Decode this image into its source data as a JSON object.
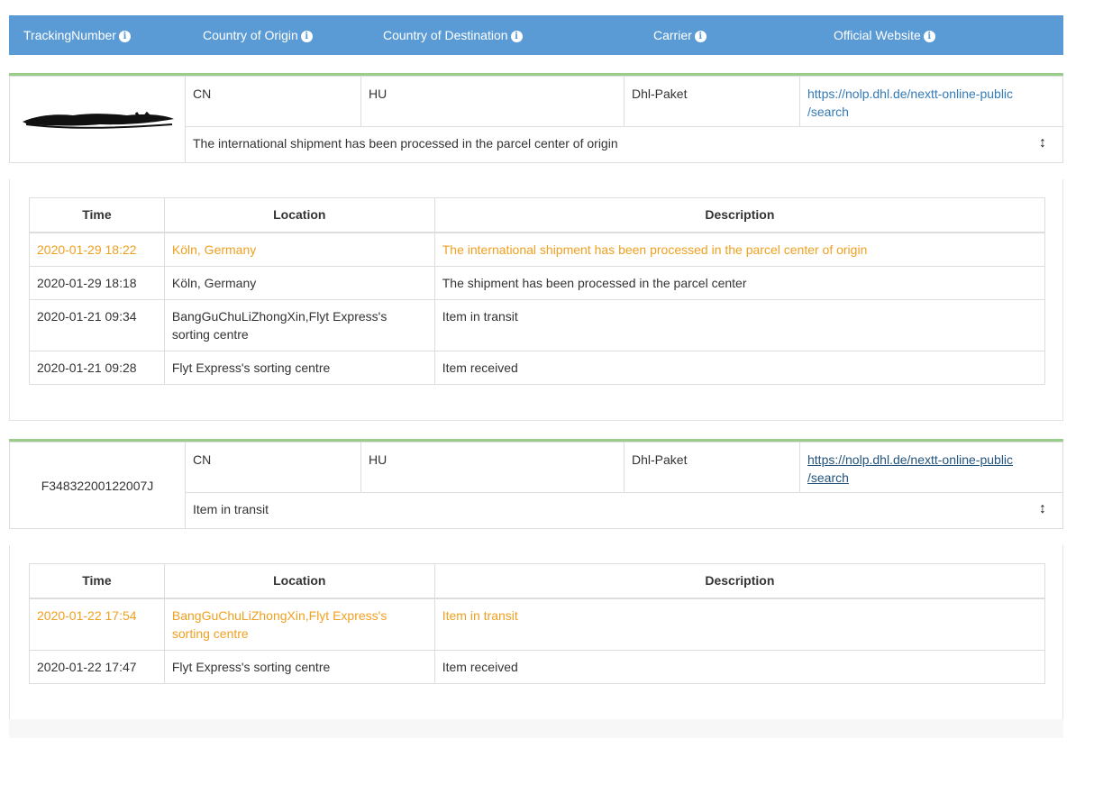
{
  "header": {
    "tracking_number": "TrackingNumber",
    "origin": "Country of Origin",
    "destination": "Country of Destination",
    "carrier": "Carrier",
    "website": "Official Website",
    "info_glyph": "i"
  },
  "table_headers": {
    "time": "Time",
    "location": "Location",
    "description": "Description"
  },
  "packages": [
    {
      "tracking_number": "",
      "origin": "CN",
      "destination": "HU",
      "carrier": "Dhl-Paket",
      "website_line1": "https://nolp.dhl.de/nextt-online-public",
      "website_line2": "/search",
      "status": "The international shipment has been processed in the parcel center of origin",
      "toggle": "↕",
      "events": [
        {
          "time": "2020-01-29 18:22",
          "location": "Köln, Germany",
          "description": "The international shipment has been processed in the parcel center of origin"
        },
        {
          "time": "2020-01-29 18:18",
          "location": "Köln, Germany",
          "description": "The shipment has been processed in the parcel center"
        },
        {
          "time": "2020-01-21 09:34",
          "location_line1": "BangGuChuLiZhongXin,Flyt Express's",
          "location_line2": "sorting centre",
          "description": "Item in transit"
        },
        {
          "time": "2020-01-21 09:28",
          "location": "Flyt Express's sorting centre",
          "description": "Item received"
        }
      ]
    },
    {
      "tracking_number": "F34832200122007J",
      "origin": "CN",
      "destination": "HU",
      "carrier": "Dhl-Paket",
      "website_line1": "https://nolp.dhl.de/nextt-online-public",
      "website_line2": "/search",
      "status": "Item in transit",
      "toggle": "↕",
      "events": [
        {
          "time": "2020-01-22 17:54",
          "location_line1": "BangGuChuLiZhongXin,Flyt Express's",
          "location_line2": "sorting centre",
          "description": "Item in transit"
        },
        {
          "time": "2020-01-22 17:47",
          "location": "Flyt Express's sorting centre",
          "description": "Item received"
        }
      ]
    }
  ],
  "colors": {
    "header_bg": "#5b9bd5",
    "accent_line": "#9acd8a",
    "latest_event": "#f0a020",
    "link": "#337ab7"
  }
}
